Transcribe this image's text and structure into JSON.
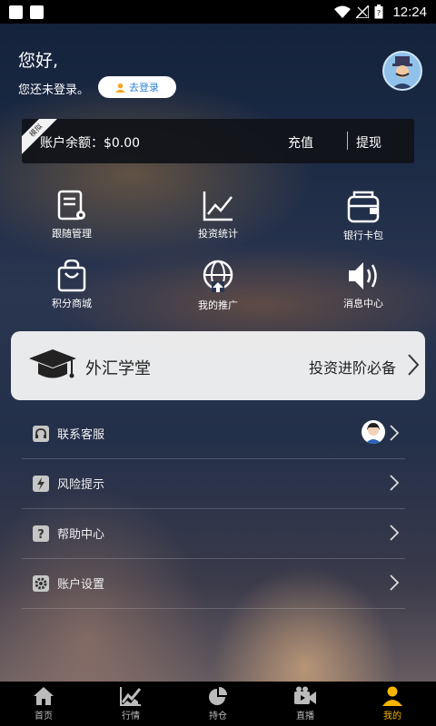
{
  "status_bar": {
    "time": "12:24"
  },
  "header": {
    "greeting": "您好,",
    "not_logged_in": "您还未登录。",
    "login_button": "去登录"
  },
  "balance": {
    "ribbon": "模拟",
    "label": "账户余额：$0.00",
    "recharge": "充值",
    "withdraw": "提现"
  },
  "grid": {
    "items": [
      {
        "label": "跟随管理",
        "icon": "follow-manage-icon"
      },
      {
        "label": "投资统计",
        "icon": "investment-chart-icon"
      },
      {
        "label": "银行卡包",
        "icon": "wallet-icon"
      },
      {
        "label": "积分商城",
        "icon": "shopping-bag-icon"
      },
      {
        "label": "我的推广",
        "icon": "globe-upload-icon"
      },
      {
        "label": "消息中心",
        "icon": "speaker-icon"
      }
    ]
  },
  "academy": {
    "title": "外汇学堂",
    "subtitle": "投资进阶必备"
  },
  "menu": {
    "items": [
      {
        "label": "联系客服",
        "icon": "headset-icon"
      },
      {
        "label": "风险提示",
        "icon": "lightning-icon"
      },
      {
        "label": "帮助中心",
        "icon": "question-icon"
      },
      {
        "label": "账户设置",
        "icon": "gear-icon"
      }
    ]
  },
  "tabbar": {
    "tabs": [
      {
        "label": "首页",
        "icon": "home-icon"
      },
      {
        "label": "行情",
        "icon": "market-chart-icon"
      },
      {
        "label": "持仓",
        "icon": "pie-chart-icon"
      },
      {
        "label": "直播",
        "icon": "video-icon"
      },
      {
        "label": "我的",
        "icon": "user-icon"
      }
    ],
    "active_color": "#f7b500"
  }
}
